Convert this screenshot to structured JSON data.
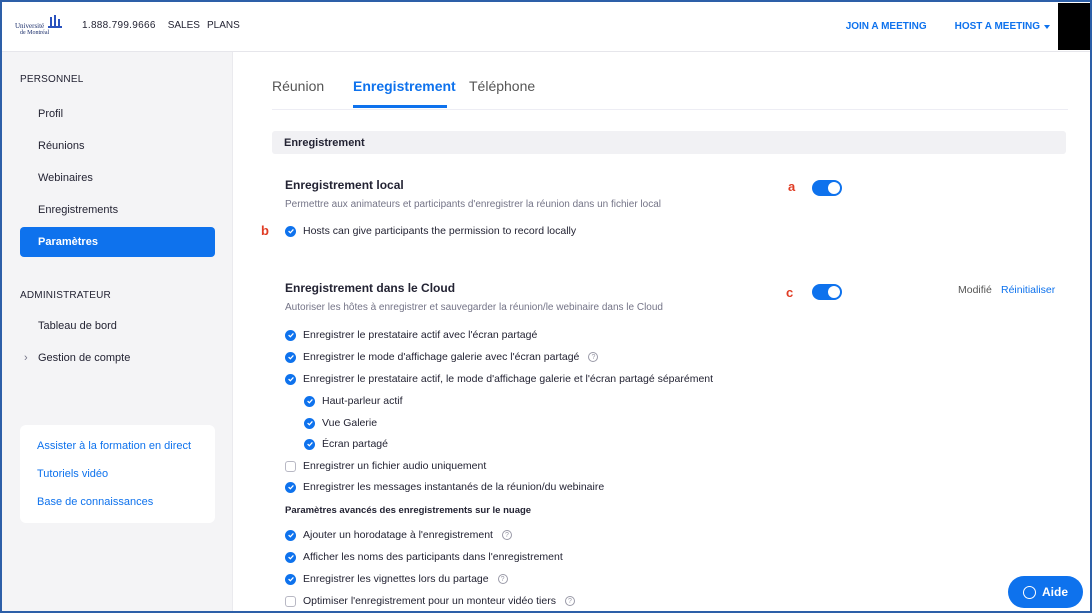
{
  "header": {
    "logo_line1": "Université",
    "logo_line2": "de Montréal",
    "phone": "1.888.799.9666",
    "sales": "SALES",
    "plans": "PLANS",
    "join_meeting": "JOIN A MEETING",
    "host_meeting": "HOST A MEETING"
  },
  "sidebar": {
    "personal_heading": "PERSONNEL",
    "items": [
      {
        "label": "Profil"
      },
      {
        "label": "Réunions"
      },
      {
        "label": "Webinaires"
      },
      {
        "label": "Enregistrements"
      },
      {
        "label": "Paramètres"
      }
    ],
    "admin_heading": "ADMINISTRATEUR",
    "admin_items": [
      {
        "label": "Tableau de bord"
      },
      {
        "label": "Gestion de compte"
      }
    ],
    "links": [
      {
        "label": "Assister à la formation en direct"
      },
      {
        "label": "Tutoriels vidéo"
      },
      {
        "label": "Base de connaissances"
      }
    ]
  },
  "tabs": [
    {
      "label": "Réunion"
    },
    {
      "label": "Enregistrement"
    },
    {
      "label": "Téléphone"
    }
  ],
  "section_title": "Enregistrement",
  "local": {
    "title": "Enregistrement local",
    "description": "Permettre aux animateurs et participants d'enregistrer la réunion dans un fichier local",
    "option": "Hosts can give participants the permission to record locally",
    "enabled": true,
    "annotation": "a",
    "option_annotation": "b"
  },
  "cloud": {
    "title": "Enregistrement dans le Cloud",
    "description": "Autoriser les hôtes à enregistrer et sauvegarder la réunion/le webinaire dans le Cloud",
    "enabled": true,
    "annotation": "c",
    "status": "Modifié",
    "reset": "Réinitialiser",
    "options": [
      {
        "label": "Enregistrer le prestataire actif avec l'écran partagé",
        "checked": true
      },
      {
        "label": "Enregistrer le mode d'affichage galerie avec l'écran partagé",
        "checked": true
      },
      {
        "label": "Enregistrer le prestataire actif, le mode d'affichage galerie et l'écran partagé séparément",
        "checked": true
      },
      {
        "label": "Haut-parleur actif",
        "checked": true
      },
      {
        "label": "Vue Galerie",
        "checked": true
      },
      {
        "label": "Écran partagé",
        "checked": true
      },
      {
        "label": "Enregistrer un fichier audio uniquement",
        "checked": false
      },
      {
        "label": "Enregistrer les messages instantanés de la réunion/du webinaire",
        "checked": true
      }
    ],
    "advanced_heading": "Paramètres avancés des enregistrements sur le nuage",
    "advanced_options": [
      {
        "label": "Ajouter un horodatage à l'enregistrement",
        "checked": true
      },
      {
        "label": "Afficher les noms des participants dans l'enregistrement",
        "checked": true
      },
      {
        "label": "Enregistrer les vignettes lors du partage",
        "checked": true
      },
      {
        "label": "Optimiser l'enregistrement pour un monteur vidéo tiers",
        "checked": false
      }
    ]
  },
  "help_button": "Aide"
}
